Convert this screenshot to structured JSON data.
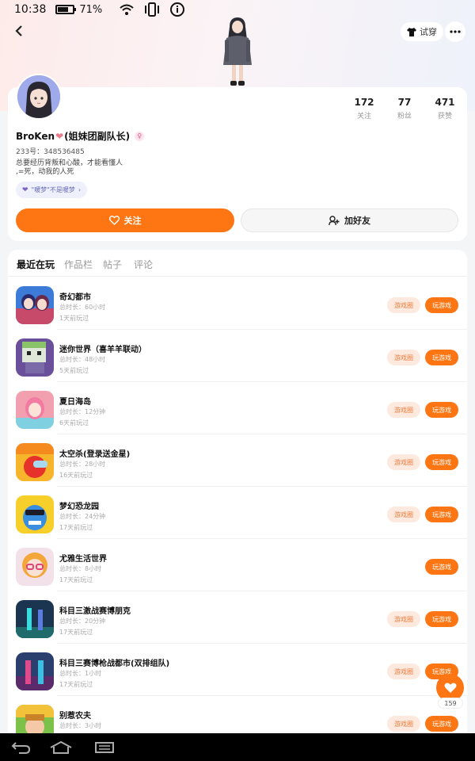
{
  "status_bar": {
    "time": "10:38",
    "battery": "71%"
  },
  "header": {
    "tryon_label": "试穿"
  },
  "profile": {
    "name": "BroKen",
    "name_suffix": "(姐妹团副队长)",
    "uid": "233号：348536485",
    "bio_line1": "总要经历背叛和心酸，才能看懂人",
    "bio_line2": ",=死，动我的人死",
    "tag": "\"暖梦\"不是暖梦",
    "stats": [
      {
        "value": "172",
        "label": "关注"
      },
      {
        "value": "77",
        "label": "粉丝"
      },
      {
        "value": "471",
        "label": "获赞"
      }
    ],
    "follow_label": "关注",
    "add_friend_label": "加好友"
  },
  "tabs": [
    "最近在玩",
    "作品栏",
    "帖子",
    "评论"
  ],
  "games": [
    {
      "name": "奇幻都市",
      "duration": "总时长：60小时",
      "last_played": "1天前玩过",
      "circle": "游戏圈",
      "play": "玩游戏",
      "icon": "fantasy-city-icon"
    },
    {
      "name": "迷你世界（喜羊羊联动）",
      "duration": "总时长：48小时",
      "last_played": "5天前玩过",
      "circle": "游戏圈",
      "play": "玩游戏",
      "icon": "mini-world-icon"
    },
    {
      "name": "夏日海岛",
      "duration": "总时长：12分钟",
      "last_played": "6天前玩过",
      "circle": "游戏圈",
      "play": "玩游戏",
      "icon": "summer-island-icon"
    },
    {
      "name": "太空杀(登录送金星)",
      "duration": "总时长：28小时",
      "last_played": "16天前玩过",
      "circle": "游戏圈",
      "play": "玩游戏",
      "icon": "space-kill-icon"
    },
    {
      "name": "梦幻恐龙园",
      "duration": "总时长：24分钟",
      "last_played": "17天前玩过",
      "circle": "游戏圈",
      "play": "玩游戏",
      "icon": "dino-park-icon"
    },
    {
      "name": "尤雅生活世界",
      "duration": "总时长：8小时",
      "last_played": "17天前玩过",
      "circle": "",
      "play": "玩游戏",
      "icon": "youya-life-icon"
    },
    {
      "name": "科目三激战赛博朋克",
      "duration": "总时长：20分钟",
      "last_played": "17天前玩过",
      "circle": "游戏圈",
      "play": "玩游戏",
      "icon": "cyberpunk-icon"
    },
    {
      "name": "科目三赛博枪战都市(双排组队)",
      "duration": "总时长：1小时",
      "last_played": "17天前玩过",
      "circle": "游戏圈",
      "play": "玩游戏",
      "icon": "cyber-gun-city-icon"
    },
    {
      "name": "别惹农夫",
      "duration": "总时长：3小时",
      "last_played": "",
      "circle": "游戏圈",
      "play": "玩游戏",
      "icon": "farmer-icon"
    }
  ],
  "float_like_count": "159",
  "colors": {
    "accent": "#fd7613",
    "circle_bg": "#fde9de"
  }
}
